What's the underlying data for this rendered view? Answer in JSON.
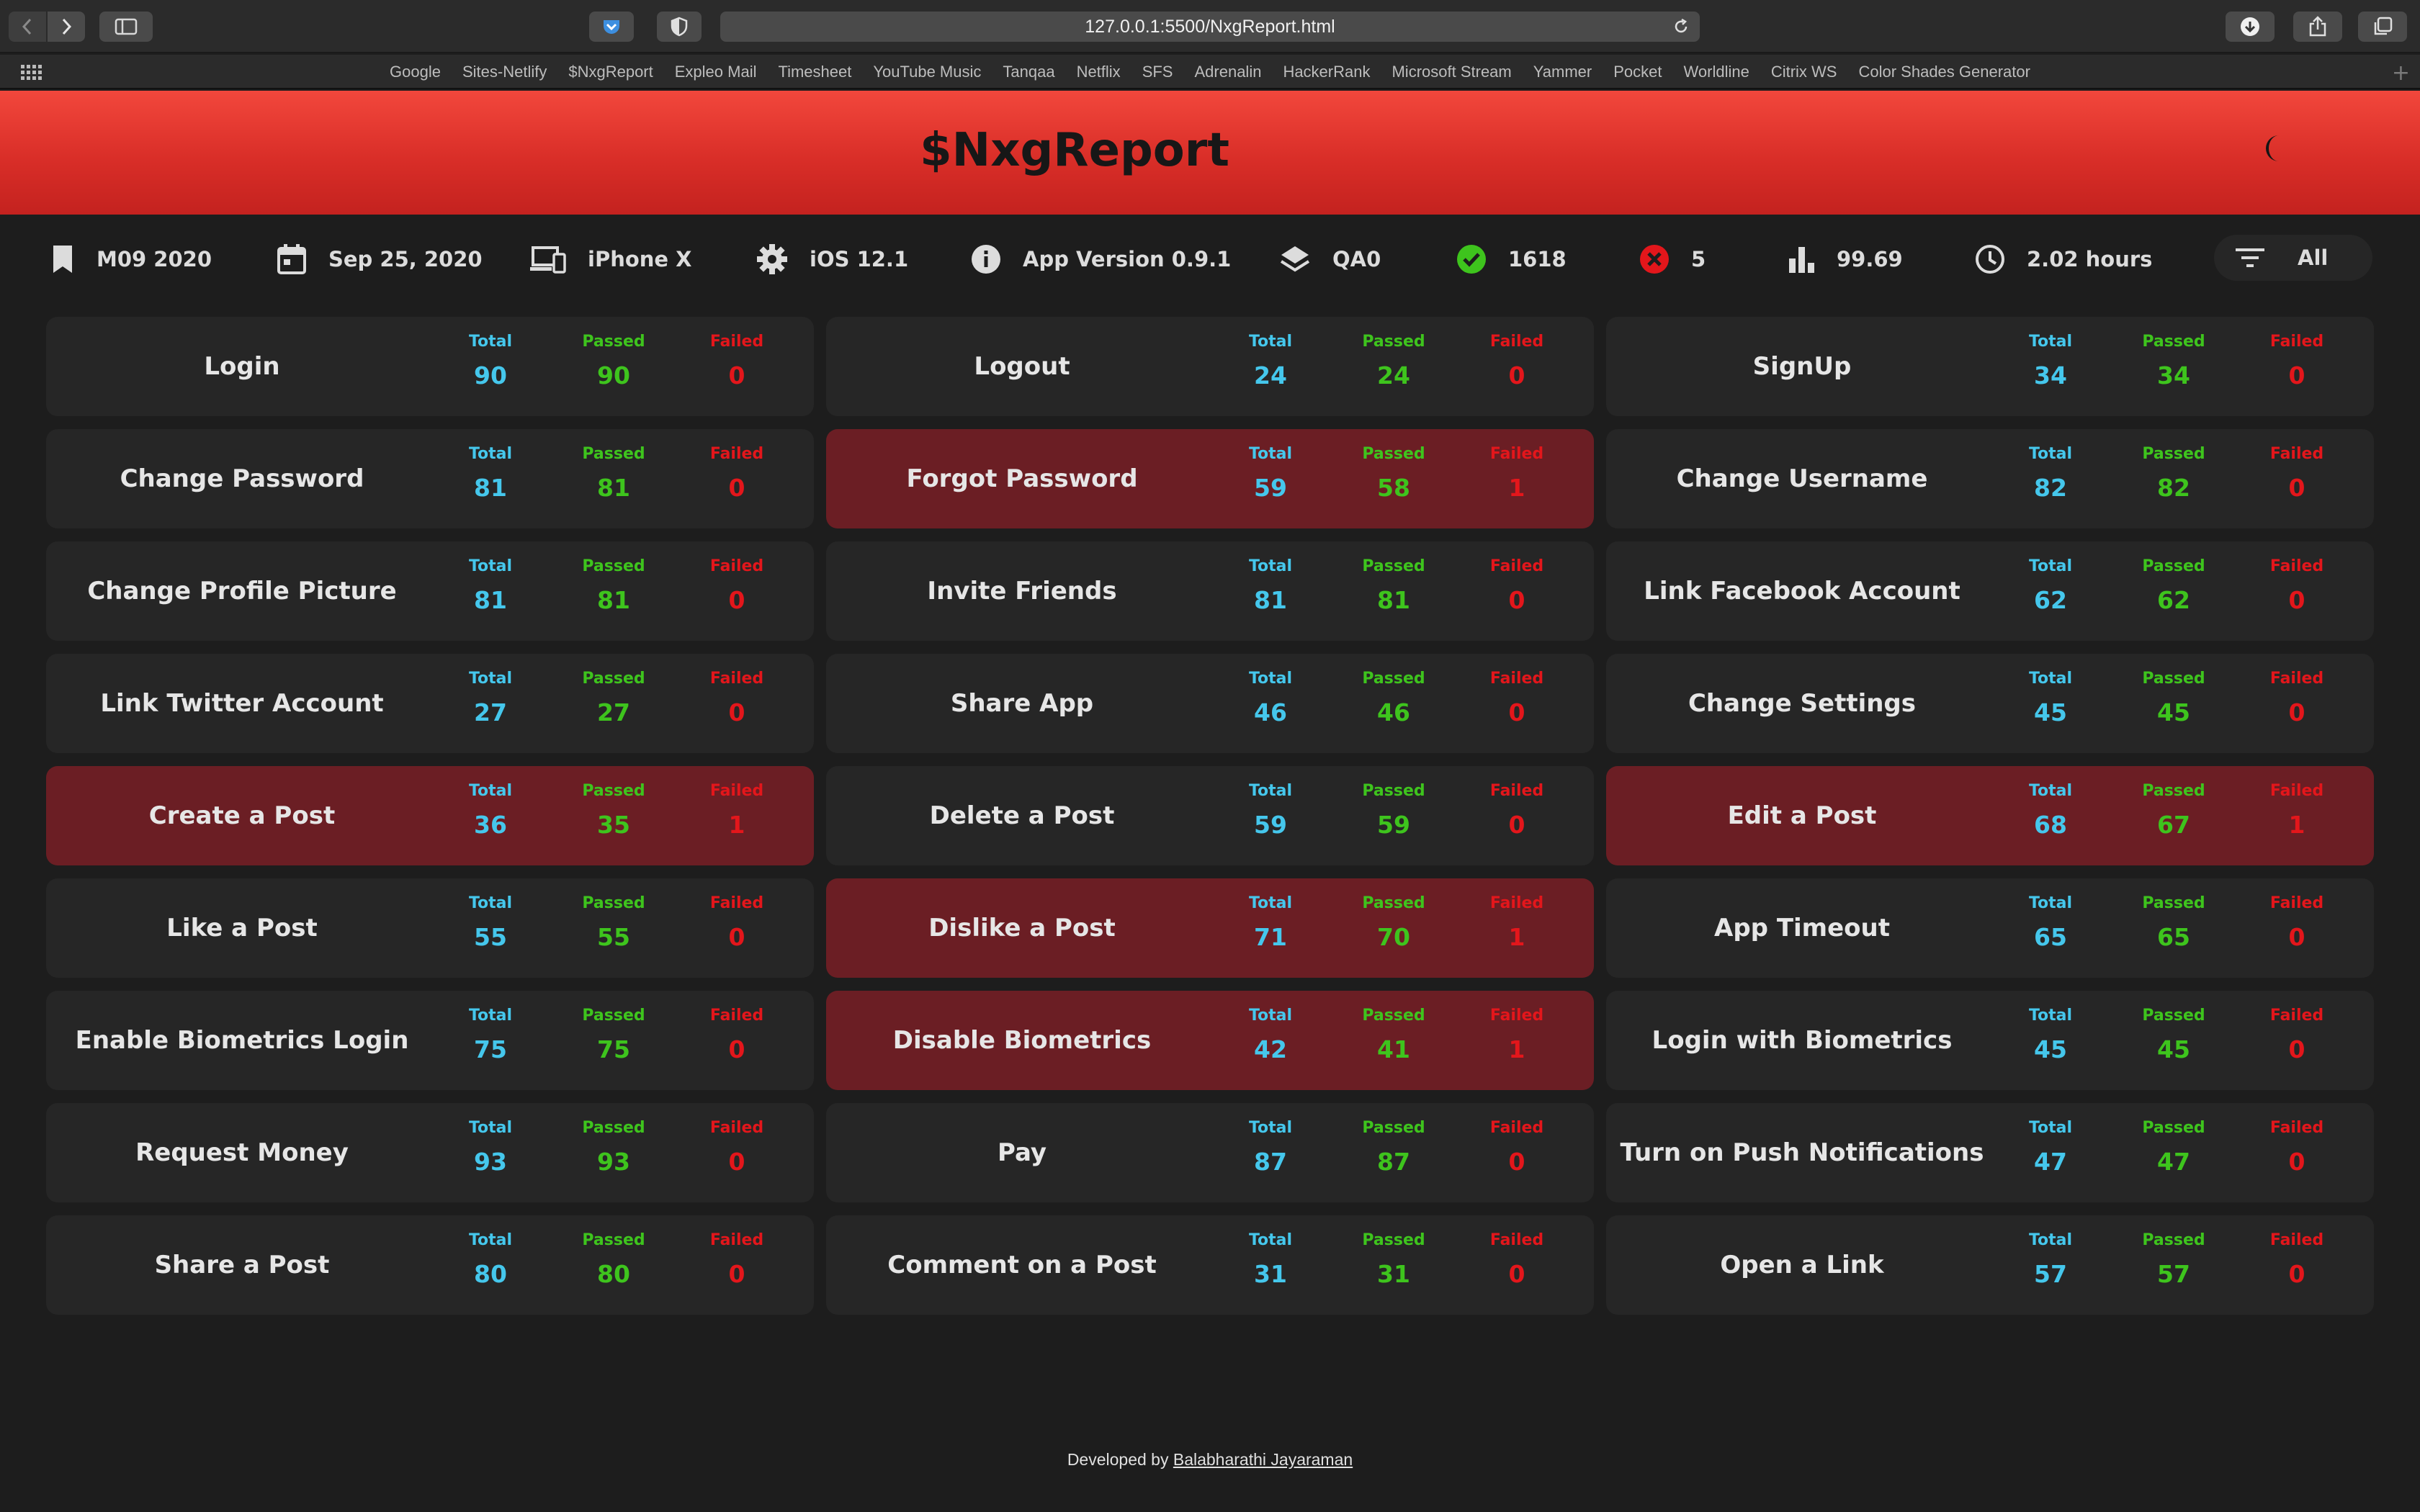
{
  "browser": {
    "url": "127.0.0.1:5500/NxgReport.html",
    "bookmarks": [
      "Google",
      "Sites-Netlify",
      "$NxgReport",
      "Expleo Mail",
      "Timesheet",
      "YouTube Music",
      "Tanqaa",
      "Netflix",
      "SFS",
      "Adrenalin",
      "HackerRank",
      "Microsoft Stream",
      "Yammer",
      "Pocket",
      "Worldline",
      "Citrix WS",
      "Color Shades Generator"
    ]
  },
  "header": {
    "title": "$NxgReport",
    "theme_toggle_icon": "moon-icon"
  },
  "info": {
    "release": "M09 2020",
    "date": "Sep 25, 2020",
    "device": "iPhone X",
    "os": "iOS 12.1",
    "app_version": "App Version 0.9.1",
    "environment": "QA0",
    "passed": "1618",
    "failed": "5",
    "pass_rate": "99.69",
    "duration": "2.02 hours",
    "filter": "All"
  },
  "labels": {
    "total": "Total",
    "passed": "Passed",
    "failed": "Failed"
  },
  "colors": {
    "header_red": "#e03a30",
    "total": "#45c7ec",
    "passed": "#3ec41d",
    "failed": "#e3161b",
    "failed_card": "#6b1e24",
    "card": "#262626"
  },
  "cards": [
    {
      "name": "Login",
      "total": "90",
      "passed": "90",
      "failed": "0"
    },
    {
      "name": "Logout",
      "total": "24",
      "passed": "24",
      "failed": "0"
    },
    {
      "name": "SignUp",
      "total": "34",
      "passed": "34",
      "failed": "0"
    },
    {
      "name": "Change Password",
      "total": "81",
      "passed": "81",
      "failed": "0"
    },
    {
      "name": "Forgot Password",
      "total": "59",
      "passed": "58",
      "failed": "1"
    },
    {
      "name": "Change Username",
      "total": "82",
      "passed": "82",
      "failed": "0"
    },
    {
      "name": "Change Profile Picture",
      "total": "81",
      "passed": "81",
      "failed": "0"
    },
    {
      "name": "Invite Friends",
      "total": "81",
      "passed": "81",
      "failed": "0"
    },
    {
      "name": "Link Facebook Account",
      "total": "62",
      "passed": "62",
      "failed": "0"
    },
    {
      "name": "Link Twitter Account",
      "total": "27",
      "passed": "27",
      "failed": "0"
    },
    {
      "name": "Share App",
      "total": "46",
      "passed": "46",
      "failed": "0"
    },
    {
      "name": "Change Settings",
      "total": "45",
      "passed": "45",
      "failed": "0"
    },
    {
      "name": "Create a Post",
      "total": "36",
      "passed": "35",
      "failed": "1"
    },
    {
      "name": "Delete a Post",
      "total": "59",
      "passed": "59",
      "failed": "0"
    },
    {
      "name": "Edit a Post",
      "total": "68",
      "passed": "67",
      "failed": "1"
    },
    {
      "name": "Like a Post",
      "total": "55",
      "passed": "55",
      "failed": "0"
    },
    {
      "name": "Dislike a Post",
      "total": "71",
      "passed": "70",
      "failed": "1"
    },
    {
      "name": "App Timeout",
      "total": "65",
      "passed": "65",
      "failed": "0"
    },
    {
      "name": "Enable Biometrics Login",
      "total": "75",
      "passed": "75",
      "failed": "0"
    },
    {
      "name": "Disable Biometrics",
      "total": "42",
      "passed": "41",
      "failed": "1"
    },
    {
      "name": "Login with Biometrics",
      "total": "45",
      "passed": "45",
      "failed": "0"
    },
    {
      "name": "Request Money",
      "total": "93",
      "passed": "93",
      "failed": "0"
    },
    {
      "name": "Pay",
      "total": "87",
      "passed": "87",
      "failed": "0"
    },
    {
      "name": "Turn on Push Notifications",
      "total": "47",
      "passed": "47",
      "failed": "0"
    },
    {
      "name": "Share a Post",
      "total": "80",
      "passed": "80",
      "failed": "0"
    },
    {
      "name": "Comment on a Post",
      "total": "31",
      "passed": "31",
      "failed": "0"
    },
    {
      "name": "Open a Link",
      "total": "57",
      "passed": "57",
      "failed": "0"
    }
  ],
  "footer": {
    "prefix": "Developed by",
    "author": "Balabharathi Jayaraman"
  }
}
